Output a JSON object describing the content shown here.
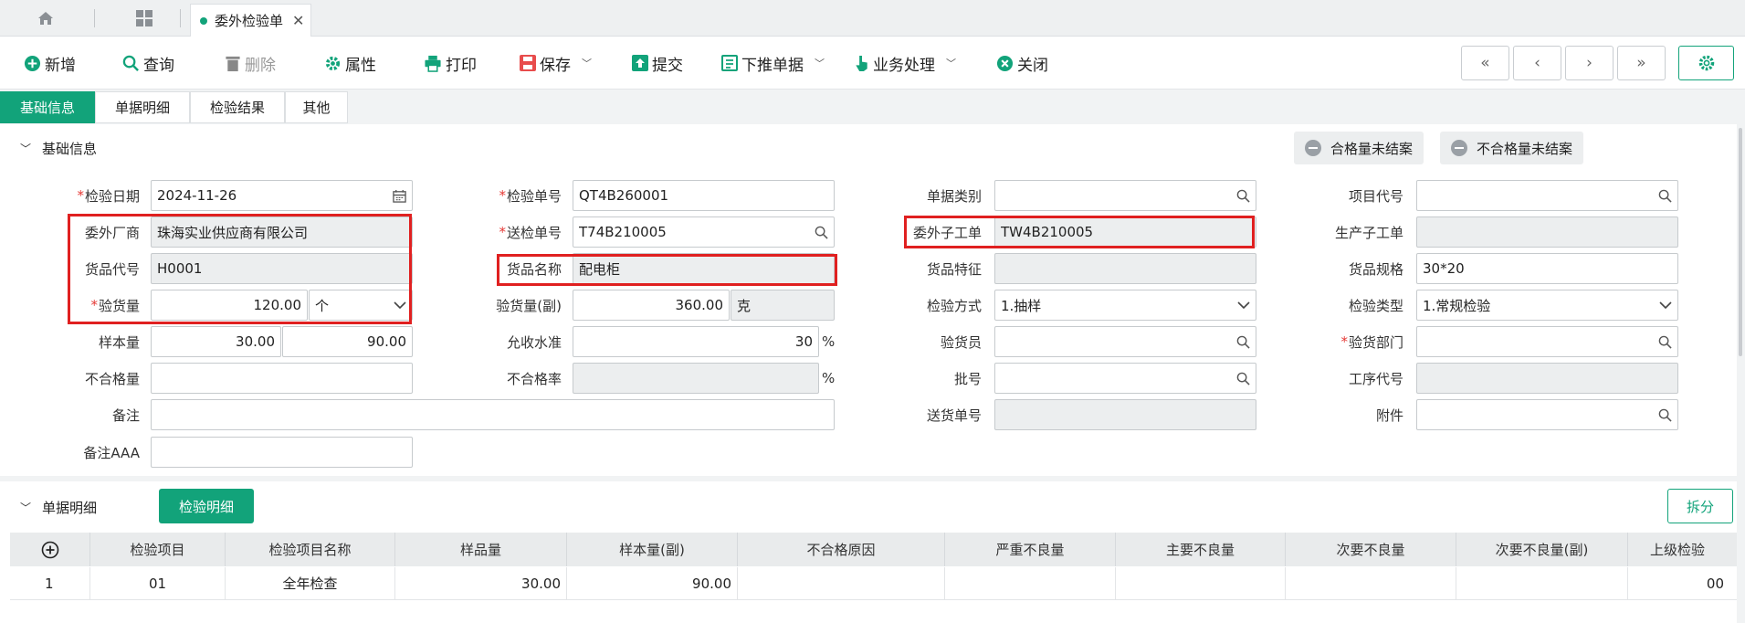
{
  "tabs": {
    "document_tab": "委外检验单"
  },
  "toolbar": {
    "add": "新增",
    "query": "查询",
    "delete": "删除",
    "properties": "属性",
    "print": "打印",
    "save": "保存",
    "submit": "提交",
    "push_down": "下推单据",
    "business": "业务处理",
    "close": "关闭"
  },
  "nav": {
    "first": "«",
    "prev": "‹",
    "next": "›",
    "last": "»"
  },
  "section_tabs": [
    "基础信息",
    "单据明细",
    "检验结果",
    "其他"
  ],
  "basic_section": {
    "title": "基础信息",
    "qualified_unsettled": "合格量未结案",
    "unqualified_unsettled": "不合格量未结案"
  },
  "form": {
    "inspection_date": {
      "label": "检验日期",
      "value": "2024-11-26"
    },
    "vendor": {
      "label": "委外厂商",
      "value": "珠海实业供应商有限公司"
    },
    "item_code": {
      "label": "货品代号",
      "value": "H0001"
    },
    "inspect_qty": {
      "label": "验货量",
      "value": "120.00",
      "unit": "个"
    },
    "sample_qty": {
      "label": "样本量",
      "value": "30.00",
      "value2": "90.00"
    },
    "unqualified_qty": {
      "label": "不合格量",
      "value": ""
    },
    "remark": {
      "label": "备注",
      "value": ""
    },
    "remark_aaa": {
      "label": "备注AAA",
      "value": ""
    },
    "inspection_no": {
      "label": "检验单号",
      "value": "QT4B260001"
    },
    "send_no": {
      "label": "送检单号",
      "value": "T74B210005"
    },
    "item_name": {
      "label": "货品名称",
      "value": "配电柜"
    },
    "inspect_qty_sub": {
      "label": "验货量(副)",
      "value": "360.00",
      "unit": "克"
    },
    "acceptance_level": {
      "label": "允收水准",
      "value": "30",
      "suffix": "%"
    },
    "unqualified_rate": {
      "label": "不合格率",
      "value": "",
      "suffix": "%"
    },
    "doc_category": {
      "label": "单据类别",
      "value": ""
    },
    "sub_work_order": {
      "label": "委外子工单",
      "value": "TW4B210005"
    },
    "item_feature": {
      "label": "货品特征",
      "value": ""
    },
    "inspect_method": {
      "label": "检验方式",
      "value": "1.抽样"
    },
    "inspector": {
      "label": "验货员",
      "value": ""
    },
    "batch_no": {
      "label": "批号",
      "value": ""
    },
    "delivery_no": {
      "label": "送货单号",
      "value": ""
    },
    "project_code": {
      "label": "项目代号",
      "value": ""
    },
    "prod_sub_order": {
      "label": "生产子工单",
      "value": ""
    },
    "item_spec": {
      "label": "货品规格",
      "value": "30*20"
    },
    "inspect_type": {
      "label": "检验类型",
      "value": "1.常规检验"
    },
    "inspect_dept": {
      "label": "验货部门",
      "value": ""
    },
    "process_code": {
      "label": "工序代号",
      "value": ""
    },
    "attachment": {
      "label": "附件",
      "value": ""
    }
  },
  "detail_section": {
    "title": "单据明细",
    "active_tab": "检验明细",
    "split_button": "拆分",
    "columns": [
      "检验项目",
      "检验项目名称",
      "样品量",
      "样本量(副)",
      "不合格原因",
      "严重不良量",
      "主要不良量",
      "次要不良量",
      "次要不良量(副)",
      "上级检验"
    ],
    "rows": [
      {
        "index": "1",
        "item": "01",
        "name": "全年检查",
        "sample": "30.00",
        "sample_sub": "90.00",
        "reason": "",
        "serious": "",
        "major": "",
        "minor": "",
        "minor_sub": "",
        "parent": "00"
      }
    ]
  },
  "colors": {
    "accent": "#12a37a",
    "highlight": "#e02020",
    "required": "#e53935"
  }
}
